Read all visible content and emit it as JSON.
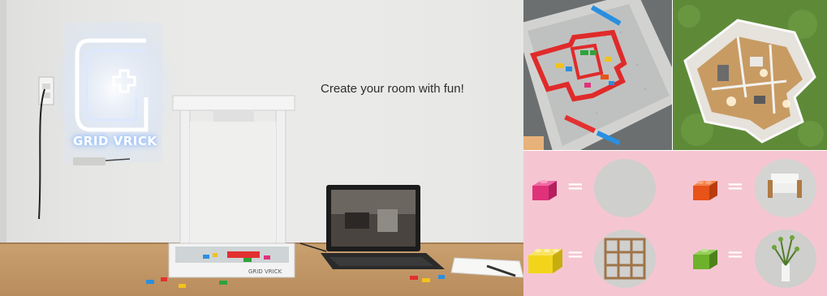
{
  "main_photo": {
    "caption": "Create your room with fun!",
    "neon_sign_text": "GRID VRICK",
    "device_label": "GRID VRICK",
    "colors": {
      "wall": "#e9e9e7",
      "table": "#c79e6f",
      "neon": "#ffffff",
      "device": "#f2f2f2"
    }
  },
  "top_left_photo": {
    "icon": "lego-floor-plan-on-grid"
  },
  "top_right_photo": {
    "icon": "3d-room-render"
  },
  "mapping_panel": {
    "background": "#f5c6d2",
    "rows": [
      {
        "brick_color": "#e0327a",
        "brick_icon": "pink-brick-icon",
        "equals": "=",
        "result_icon": "empty-floor-icon"
      },
      {
        "brick_color": "#e8531a",
        "brick_icon": "orange-brick-icon",
        "equals": "=",
        "result_icon": "armchair-icon"
      },
      {
        "brick_color": "#f2d51b",
        "brick_icon": "yellow-brick-icon",
        "equals": "=",
        "result_icon": "bookshelf-icon"
      },
      {
        "brick_color": "#6eb22c",
        "brick_icon": "green-brick-icon",
        "equals": "=",
        "result_icon": "plant-icon"
      }
    ]
  }
}
